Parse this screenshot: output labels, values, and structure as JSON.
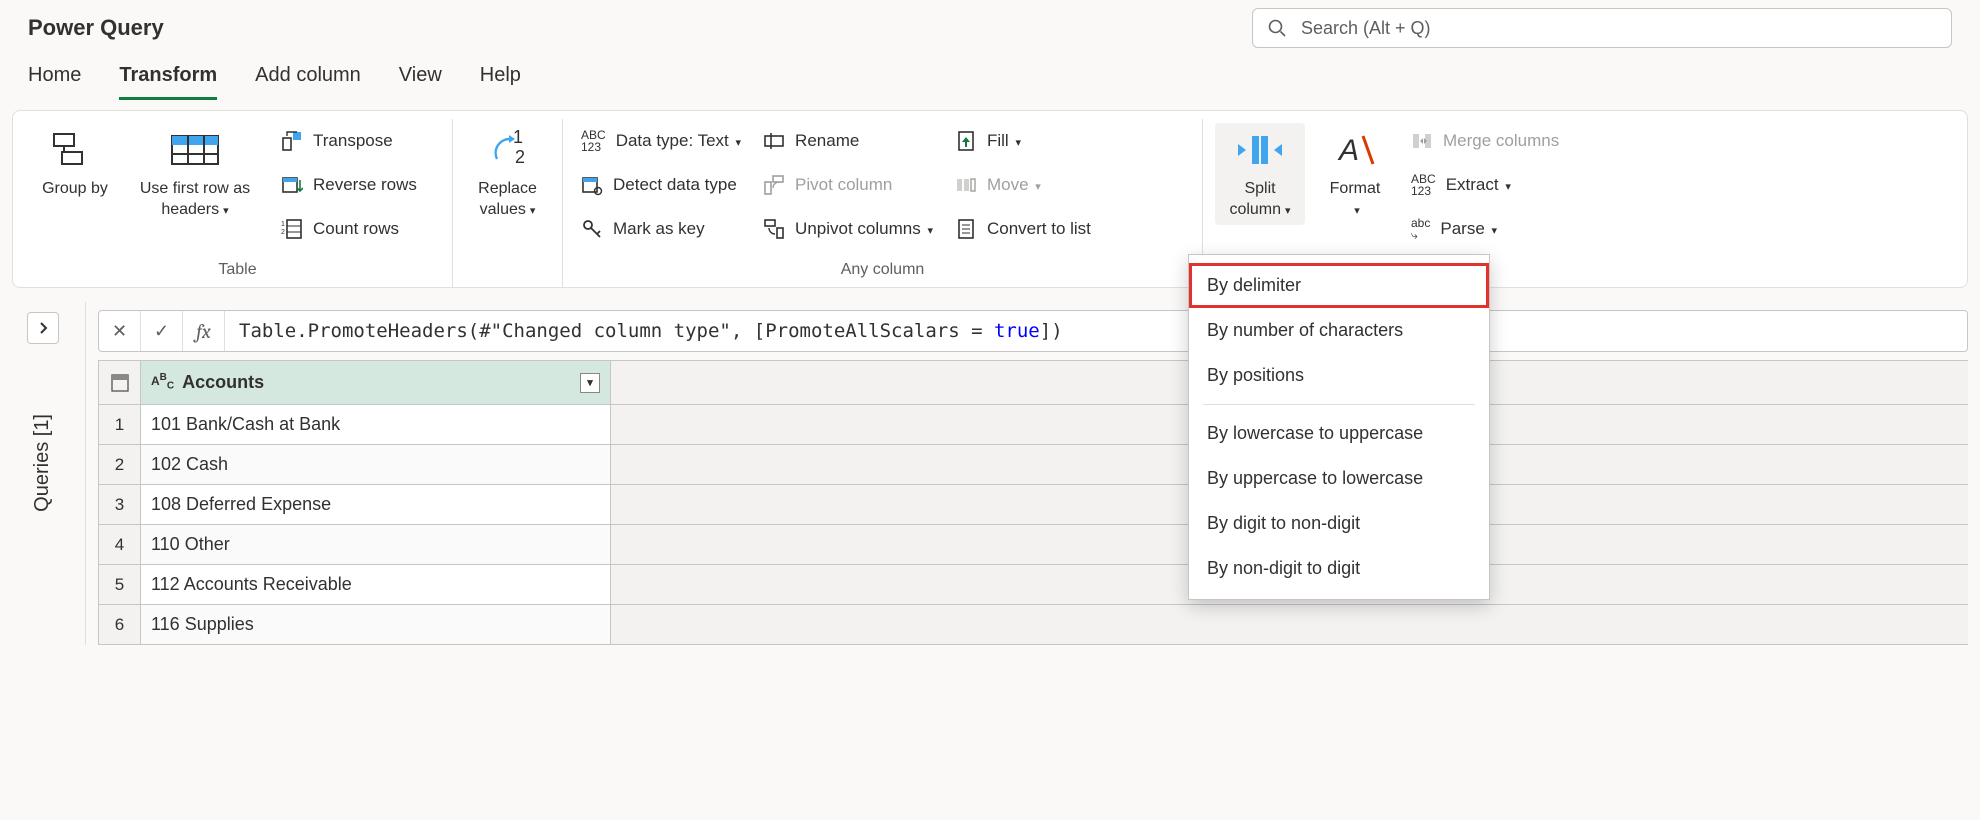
{
  "app": {
    "title": "Power Query"
  },
  "search": {
    "placeholder": "Search (Alt + Q)"
  },
  "tabs": [
    {
      "label": "Home"
    },
    {
      "label": "Transform",
      "active": true
    },
    {
      "label": "Add column"
    },
    {
      "label": "View"
    },
    {
      "label": "Help"
    }
  ],
  "ribbon": {
    "group_table": {
      "label": "Table",
      "group_by": "Group by",
      "use_first_row": "Use first row as headers",
      "transpose": "Transpose",
      "reverse_rows": "Reverse rows",
      "count_rows": "Count rows"
    },
    "group_replace": {
      "replace_values": "Replace values"
    },
    "group_anycol": {
      "label": "Any column",
      "data_type": "Data type: Text",
      "detect": "Detect data type",
      "mark_key": "Mark as key",
      "rename": "Rename",
      "pivot": "Pivot column",
      "unpivot": "Unpivot columns",
      "fill": "Fill",
      "move": "Move",
      "convert_list": "Convert to list"
    },
    "group_text": {
      "split_column": "Split column",
      "format": "Format",
      "merge": "Merge columns",
      "extract": "Extract",
      "parse": "Parse"
    }
  },
  "queries_panel": {
    "label": "Queries [1]"
  },
  "formula": {
    "prefix": "Table.PromoteHeaders(#\"Changed column type\", [PromoteAllScalars = ",
    "keyword": "true",
    "suffix": "])"
  },
  "grid": {
    "column_header": "Accounts",
    "rows": [
      "101 Bank/Cash at Bank",
      "102 Cash",
      "108 Deferred Expense",
      "110 Other",
      "112 Accounts Receivable",
      "116 Supplies"
    ]
  },
  "dropdown": {
    "items": [
      {
        "label": "By delimiter",
        "highlight": true
      },
      {
        "label": "By number of characters"
      },
      {
        "label": "By positions"
      }
    ],
    "items2": [
      {
        "label": "By lowercase to uppercase"
      },
      {
        "label": "By uppercase to lowercase"
      },
      {
        "label": "By digit to non-digit"
      },
      {
        "label": "By non-digit to digit"
      }
    ]
  },
  "chart_data": {
    "type": "table",
    "columns": [
      "Accounts"
    ],
    "rows": [
      [
        "101 Bank/Cash at Bank"
      ],
      [
        "102 Cash"
      ],
      [
        "108 Deferred Expense"
      ],
      [
        "110 Other"
      ],
      [
        "112 Accounts Receivable"
      ],
      [
        "116 Supplies"
      ]
    ]
  }
}
